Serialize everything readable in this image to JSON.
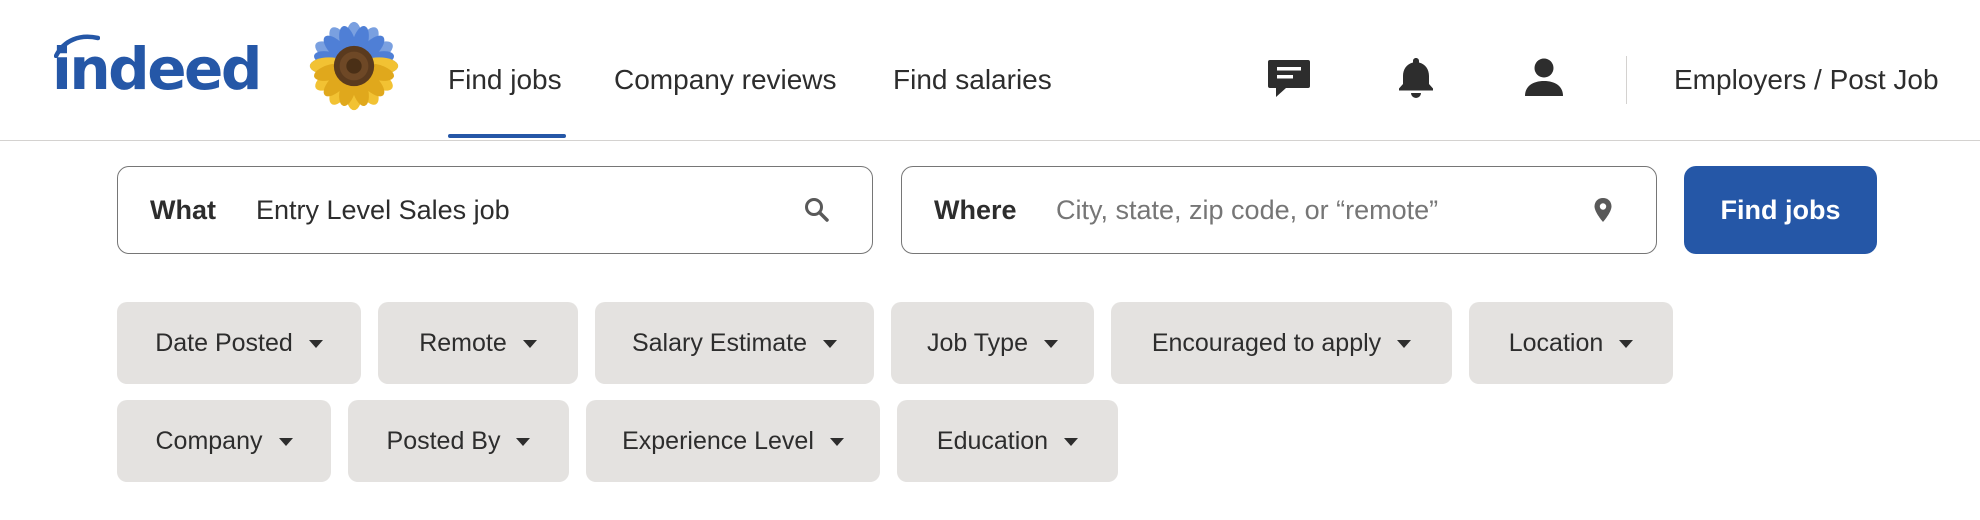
{
  "brand": {
    "logo_text": "indeed",
    "accent": "#2557a7"
  },
  "nav": {
    "links": [
      {
        "label": "Find jobs",
        "active": true
      },
      {
        "label": "Company reviews",
        "active": false
      },
      {
        "label": "Find salaries",
        "active": false
      }
    ],
    "icons": [
      "messages-icon",
      "notifications-bell-icon",
      "account-person-icon"
    ],
    "employers_label": "Employers / Post Job"
  },
  "search": {
    "what_label": "What",
    "what_value": "Entry Level Sales job",
    "where_label": "Where",
    "where_value": "",
    "where_placeholder": "City, state, zip code, or “remote”",
    "submit_label": "Find jobs"
  },
  "filters": {
    "row1": [
      "Date Posted",
      "Remote",
      "Salary Estimate",
      "Job Type",
      "Encouraged to apply",
      "Location"
    ],
    "row2": [
      "Company",
      "Posted By",
      "Experience Level",
      "Education"
    ]
  },
  "colors": {
    "chip_bg": "#e4e2e0",
    "button_bg": "#2557a7",
    "text": "#2d2d2d"
  }
}
